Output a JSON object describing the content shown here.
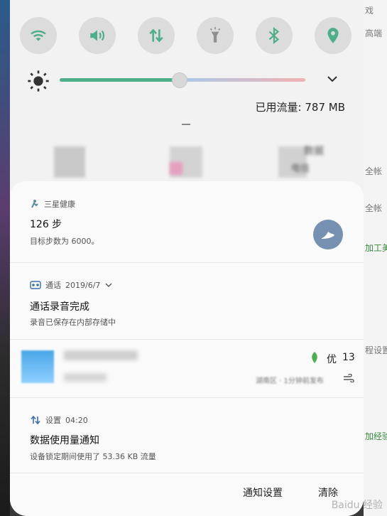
{
  "bg_right_texts": [
    "戏",
    "高端",
    "全帐",
    "全帐",
    "加工美",
    "程设置",
    "加经验"
  ],
  "quick": [
    {
      "name": "wifi-icon"
    },
    {
      "name": "sound-icon"
    },
    {
      "name": "data-icon"
    },
    {
      "name": "flashlight-icon"
    },
    {
      "name": "bluetooth-icon"
    },
    {
      "name": "location-icon"
    }
  ],
  "usage_text": "已用流量: 787 MB",
  "blurred_labels": [
    "数据",
    "电信"
  ],
  "notifications": {
    "health": {
      "app": "三星健康",
      "title": "126 步",
      "sub": "目标步数为 6000。"
    },
    "call": {
      "app": "通话",
      "date": "2019/6/7",
      "title": "通话录音完成",
      "sub": "录音已保存在内部存储中"
    },
    "weather": {
      "aqi_label": "优",
      "aqi_value": "13",
      "meta": "湖南区 · 1分钟前发布"
    },
    "settings": {
      "app": "设置",
      "time": "04:20",
      "title": "数据使用量通知",
      "sub": "设备锁定期间使用了 53.36 KB 流量"
    }
  },
  "footer": {
    "notif_settings": "通知设置",
    "clear": "清除"
  },
  "watermark": "Baidu 经验"
}
